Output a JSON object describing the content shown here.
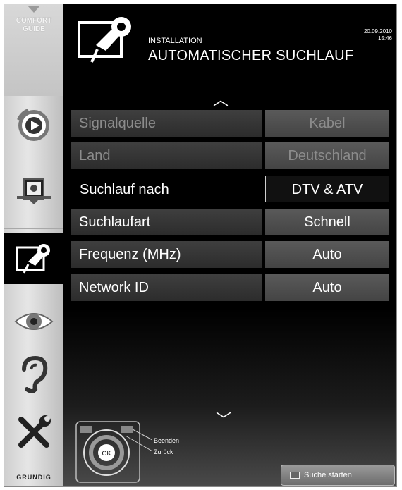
{
  "sidebar": {
    "guide_label_line1": "COMFORT",
    "guide_label_line2": "GUIDE",
    "items": [
      {
        "icon": "playback-icon"
      },
      {
        "icon": "source-device-icon"
      },
      {
        "icon": "installation-plug-icon"
      },
      {
        "icon": "picture-eye-icon"
      },
      {
        "icon": "audio-ear-icon"
      },
      {
        "icon": "tools-icon"
      }
    ],
    "brand": "GRUNDIG"
  },
  "header": {
    "section": "INSTALLATION",
    "title": "AUTOMATISCHER SUCHLAUF",
    "date": "20.09.2010",
    "time": "15:46"
  },
  "menu": {
    "rows": [
      {
        "label": "Signalquelle",
        "value": "Kabel",
        "state": "dim"
      },
      {
        "label": "Land",
        "value": "Deutschland",
        "state": "dim"
      },
      {
        "label": "Suchlauf nach",
        "value": "DTV & ATV",
        "state": "selected"
      },
      {
        "label": "Suchlaufart",
        "value": "Schnell",
        "state": "normal"
      },
      {
        "label": "Frequenz (MHz)",
        "value": "Auto",
        "state": "normal"
      },
      {
        "label": "Network ID",
        "value": "Auto",
        "state": "normal"
      }
    ]
  },
  "footer": {
    "remote_ok": "OK",
    "exit_label": "Beenden",
    "back_label": "Zurück",
    "start_label": "Suche starten"
  }
}
